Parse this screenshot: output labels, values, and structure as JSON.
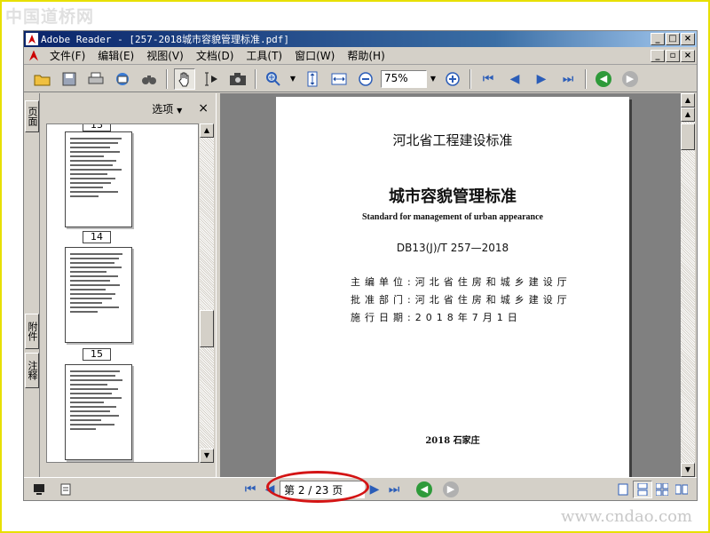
{
  "watermark_top": "中国道桥网",
  "watermark_bottom": "www.cndao.com",
  "window": {
    "title": "Adobe Reader - [257-2018城市容貌管理标准.pdf]",
    "controls": [
      "_",
      "□",
      "×"
    ]
  },
  "menu": {
    "items": [
      "文件(F)",
      "编辑(E)",
      "视图(V)",
      "文档(D)",
      "工具(T)",
      "窗口(W)",
      "帮助(H)"
    ],
    "doc_controls": [
      "_",
      "▫",
      "×"
    ]
  },
  "toolbar": {
    "zoom": "75%"
  },
  "left_tabs": {
    "pages": "页面",
    "attachments": "附件",
    "comments": "注释"
  },
  "nav_panel": {
    "options_label": "选项",
    "close_label": "×",
    "thumbnails": [
      {
        "label": "13"
      },
      {
        "label": "14"
      },
      {
        "label": "15"
      }
    ]
  },
  "document": {
    "header": "河北省工程建设标准",
    "title": "城市容貌管理标准",
    "subtitle_en": "Standard for management of urban appearance",
    "code": "DB13(J)/T 257—2018",
    "rows": [
      {
        "label": "主编单位:",
        "value": "河北省住房和城乡建设厅"
      },
      {
        "label": "批准部门:",
        "value": "河北省住房和城乡建设厅"
      },
      {
        "label": "施行日期:",
        "value": "2018年7月1日"
      }
    ],
    "footer": "2018 石家庄"
  },
  "status": {
    "page_display": "第 2 / 23 页",
    "highlight_color": "#d41414"
  }
}
